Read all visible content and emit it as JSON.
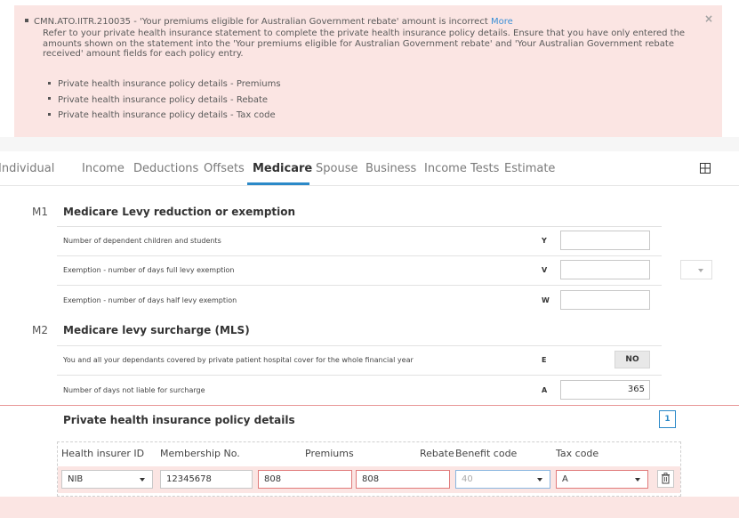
{
  "alert": {
    "code_message": "CMN.ATO.IITR.210035 - 'Your premiums eligible for Australian Government rebate' amount is incorrect",
    "more_link": "More",
    "close_glyph": "×",
    "description": "Refer to your private health insurance statement to complete the private health insurance policy details. Ensure that you have only entered the amounts shown on the statement into the 'Your premiums eligible for Australian Government rebate' and 'Your Australian Government rebate received' amount fields for each policy entry.",
    "items": [
      "Private health insurance policy details - Premiums",
      "Private health insurance policy details - Rebate",
      "Private health insurance policy details - Tax code"
    ]
  },
  "tabs": [
    {
      "label": "Individual"
    },
    {
      "label": "Income"
    },
    {
      "label": "Deductions"
    },
    {
      "label": "Offsets"
    },
    {
      "label": "Medicare",
      "active": true
    },
    {
      "label": "Spouse"
    },
    {
      "label": "Business"
    },
    {
      "label": "Income Tests"
    },
    {
      "label": "Estimate"
    }
  ],
  "m1": {
    "num": "M1",
    "title": "Medicare Levy reduction or exemption",
    "rows": [
      {
        "label": "Number of dependent children and students",
        "code": "Y",
        "value": ""
      },
      {
        "label": "Exemption - number of days full levy exemption",
        "code": "V",
        "value": ""
      },
      {
        "label": "Exemption - number of days half levy exemption",
        "code": "W",
        "value": ""
      }
    ]
  },
  "m2": {
    "num": "M2",
    "title": "Medicare levy surcharge (MLS)",
    "rows": [
      {
        "label": "You and all your dependants covered by private patient hospital cover for the whole financial year",
        "code": "E",
        "toggle": "NO"
      },
      {
        "label": "Number of days not liable for surcharge",
        "code": "A",
        "value": "365"
      }
    ]
  },
  "phi": {
    "title": "Private health insurance policy details",
    "count": "1",
    "columns": {
      "insurer": "Health insurer ID",
      "membership": "Membership No.",
      "premiums": "Premiums",
      "rebate": "Rebate",
      "benefit": "Benefit code",
      "tax": "Tax code"
    },
    "row": {
      "insurer": "NIB",
      "membership": "12345678",
      "premiums": "808",
      "rebate": "808",
      "benefit": "40",
      "tax": "A"
    }
  },
  "colors": {
    "accent": "#2b89c8",
    "error_bg": "#fbe5e3",
    "error_border": "#e07a7a"
  }
}
